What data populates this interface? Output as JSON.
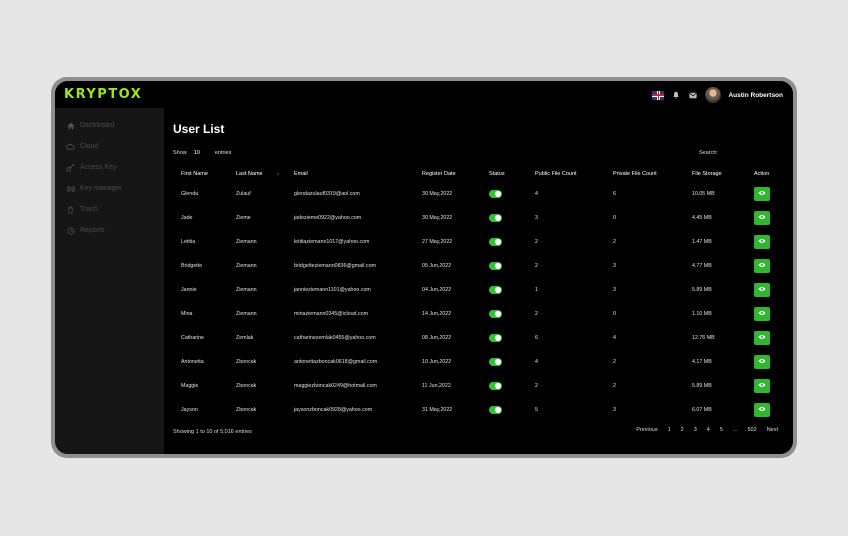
{
  "brand": {
    "logo": "KRYPTOX",
    "accent": "#9ae51f"
  },
  "topbar": {
    "username": "Austin Robertson",
    "icons": [
      "uk-flag-icon",
      "bell-icon",
      "mail-icon",
      "avatar"
    ]
  },
  "sidebar": {
    "items": [
      {
        "label": "Dashboard",
        "icon": "home-icon"
      },
      {
        "label": "Cloud",
        "icon": "cloud-icon"
      },
      {
        "label": "Access Key",
        "icon": "key-icon"
      },
      {
        "label": "Key manager",
        "icon": "command-icon"
      },
      {
        "label": "Trash",
        "icon": "trash-icon"
      },
      {
        "label": "Reports",
        "icon": "reports-icon"
      }
    ]
  },
  "main": {
    "title": "User List",
    "show_label": "Show",
    "entries_value": "10",
    "entries_label": "entries",
    "search_label": "Search:",
    "columns": [
      "First Name",
      "Last Name",
      "Email",
      "Register Date",
      "Status",
      "Public File Count",
      "Private File Count",
      "File Storage",
      "Action"
    ],
    "rows": [
      {
        "first": "Glenda",
        "last": "Zulauf",
        "email": "glendazulauf0319@aol.com",
        "date": "30 May,2022",
        "public": "4",
        "private": "6",
        "storage": "10.05 MB"
      },
      {
        "first": "Jade",
        "last": "Zieme",
        "email": "jadezieme0922@yahoo.com",
        "date": "30 May,2022",
        "public": "3",
        "private": "0",
        "storage": "4.45 MB"
      },
      {
        "first": "Letitia",
        "last": "Ziemann",
        "email": "letitiaziemann1017@yahoo.com",
        "date": "27 May,2022",
        "public": "2",
        "private": "2",
        "storage": "1.47 MB"
      },
      {
        "first": "Bridgette",
        "last": "Ziemann",
        "email": "bridgetteziemann0836@gmail.com",
        "date": "05 Jun,2022",
        "public": "2",
        "private": "3",
        "storage": "4.77 MB"
      },
      {
        "first": "Jannie",
        "last": "Ziemann",
        "email": "jannieziemann1101@yahoo.com",
        "date": "04 Jun,2022",
        "public": "1",
        "private": "3",
        "storage": "5.89 MB"
      },
      {
        "first": "Mina",
        "last": "Ziemann",
        "email": "minaziemann0345@icloud.com",
        "date": "14 Jun,2022",
        "public": "2",
        "private": "0",
        "storage": "1.10 MB"
      },
      {
        "first": "Catharine",
        "last": "Zemlak",
        "email": "catharinezemlak0455@yahoo.com",
        "date": "08 Jun,2022",
        "public": "6",
        "private": "4",
        "storage": "12.76 MB"
      },
      {
        "first": "Antonetta",
        "last": "Zboncak",
        "email": "antonettazboncak0618@gmail.com",
        "date": "10 Jun,2022",
        "public": "4",
        "private": "2",
        "storage": "4.17 MB"
      },
      {
        "first": "Maggie",
        "last": "Zboncak",
        "email": "maggiezboncak0249@hotmail.com",
        "date": "11 Jun,2022",
        "public": "2",
        "private": "2",
        "storage": "5.89 MB"
      },
      {
        "first": "Jayson",
        "last": "Zboncak",
        "email": "jaysonzboncak0928@yahoo.com",
        "date": "31 May,2022",
        "public": "5",
        "private": "3",
        "storage": "6.07 MB"
      }
    ],
    "footer_info": "Showing 1 to 10 of 5,016 entries",
    "pagination": [
      "Previous",
      "1",
      "2",
      "3",
      "4",
      "5",
      "...",
      "502",
      "Next"
    ]
  }
}
